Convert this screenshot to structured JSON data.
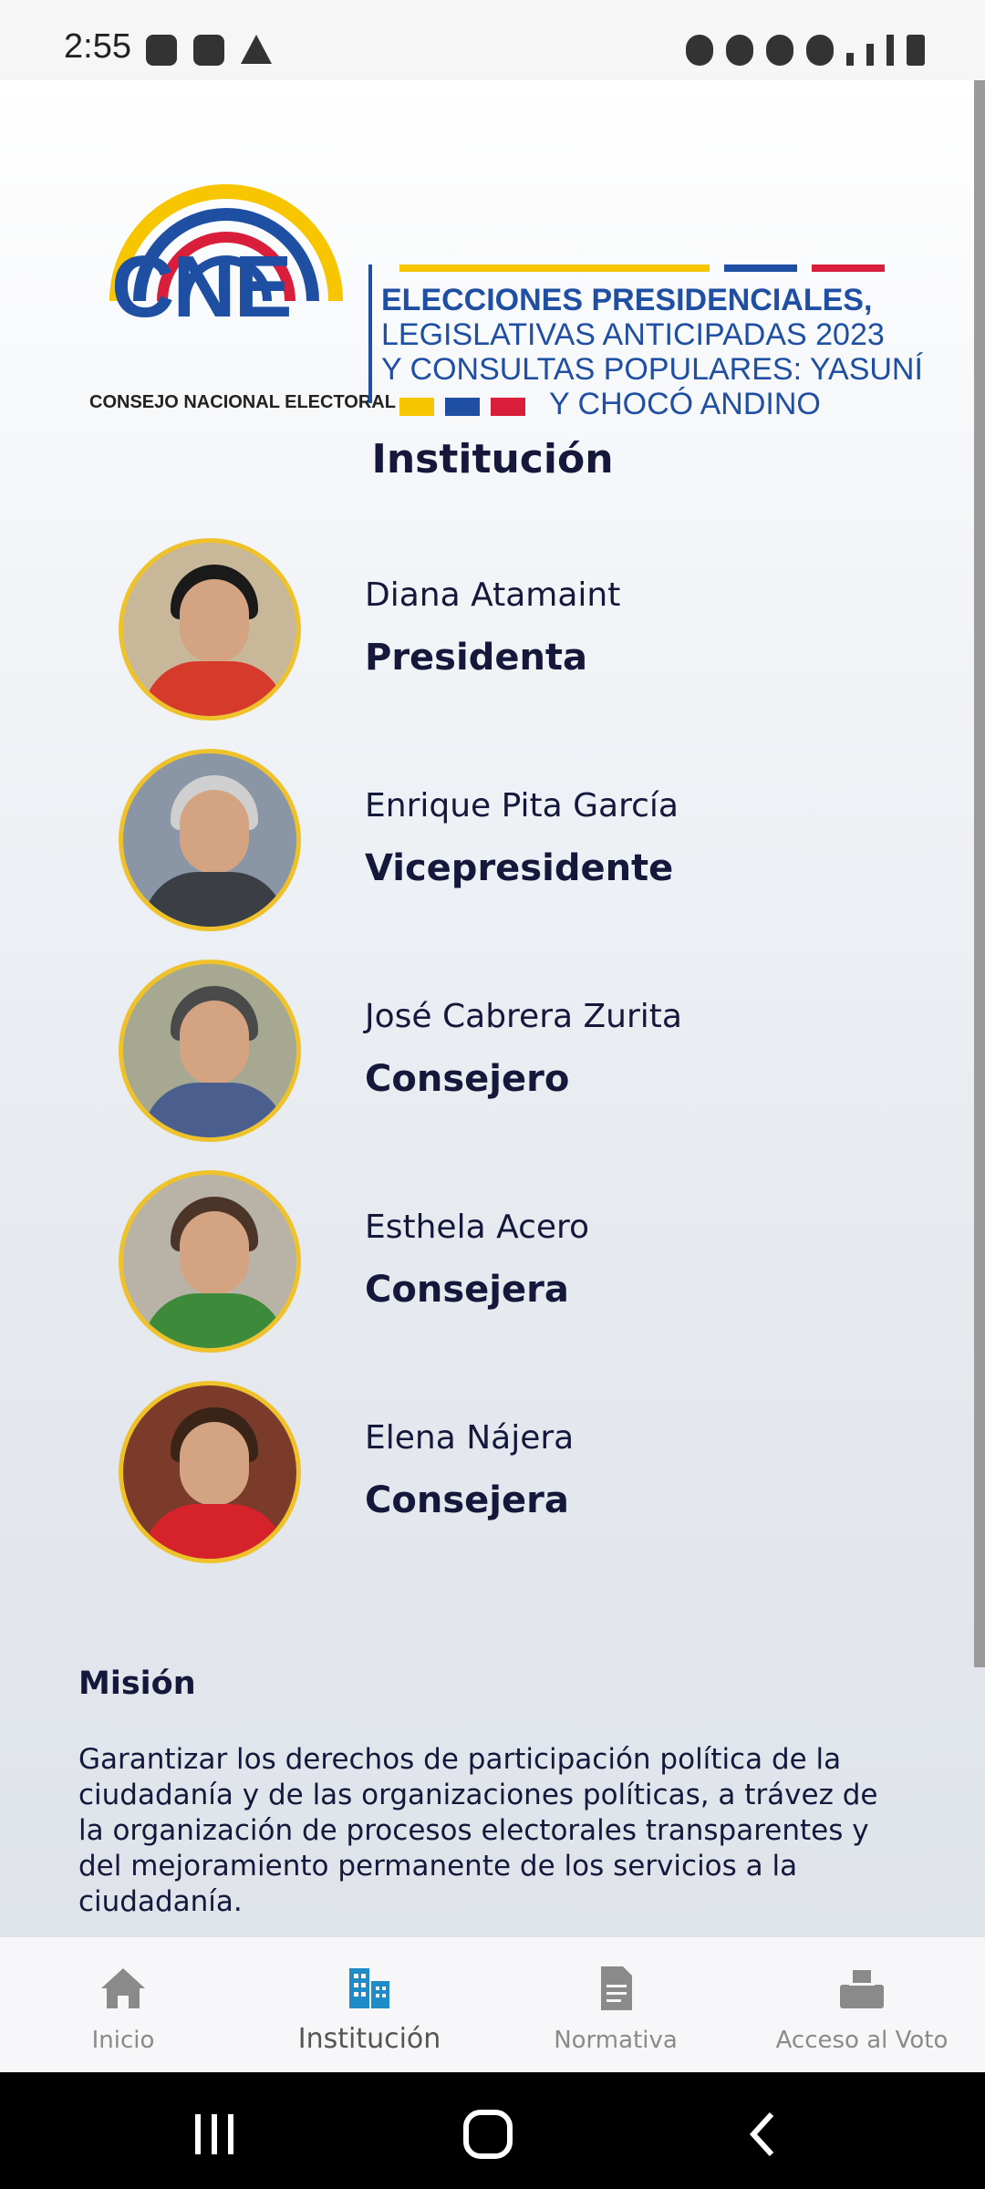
{
  "status_bar": {
    "time": "2:55"
  },
  "logo": {
    "acronym": "CNE",
    "org_name": "CONSEJO NACIONAL ELECTORAL",
    "line1": "ELECCIONES PRESIDENCIALES,",
    "line2": "LEGISLATIVAS ANTICIPADAS 2023",
    "line3": "Y CONSULTAS POPULARES: YASUNÍ",
    "line4": "Y CHOCÓ ANDINO"
  },
  "page": {
    "title": "Institución"
  },
  "members": [
    {
      "name": "Diana Atamaint",
      "role": "Presidenta"
    },
    {
      "name": "Enrique Pita García",
      "role": "Vicepresidente"
    },
    {
      "name": "José Cabrera Zurita",
      "role": "Consejero"
    },
    {
      "name": "Esthela Acero",
      "role": "Consejera"
    },
    {
      "name": "Elena Nájera",
      "role": "Consejera"
    }
  ],
  "mision": {
    "title": "Misión",
    "text": "Garantizar los derechos de participación política de la ciudadanía y de las organizaciones políticas, a trávez de la organización de procesos electorales transparentes y del mejoramiento permanente de los servicios a la ciudadanía."
  },
  "bottom_nav": [
    {
      "label": "Inicio",
      "icon": "home-icon"
    },
    {
      "label": "Institución",
      "icon": "building-icon"
    },
    {
      "label": "Normativa",
      "icon": "document-icon"
    },
    {
      "label": "Acceso al Voto",
      "icon": "ballot-box-icon"
    }
  ],
  "colors": {
    "accent": "#1f8bc7",
    "text_dark": "#15183a",
    "avatar_border": "#efc22b",
    "cne_blue": "#1f4fa3",
    "flag_yellow": "#f7c600",
    "flag_red": "#d81e3a"
  }
}
